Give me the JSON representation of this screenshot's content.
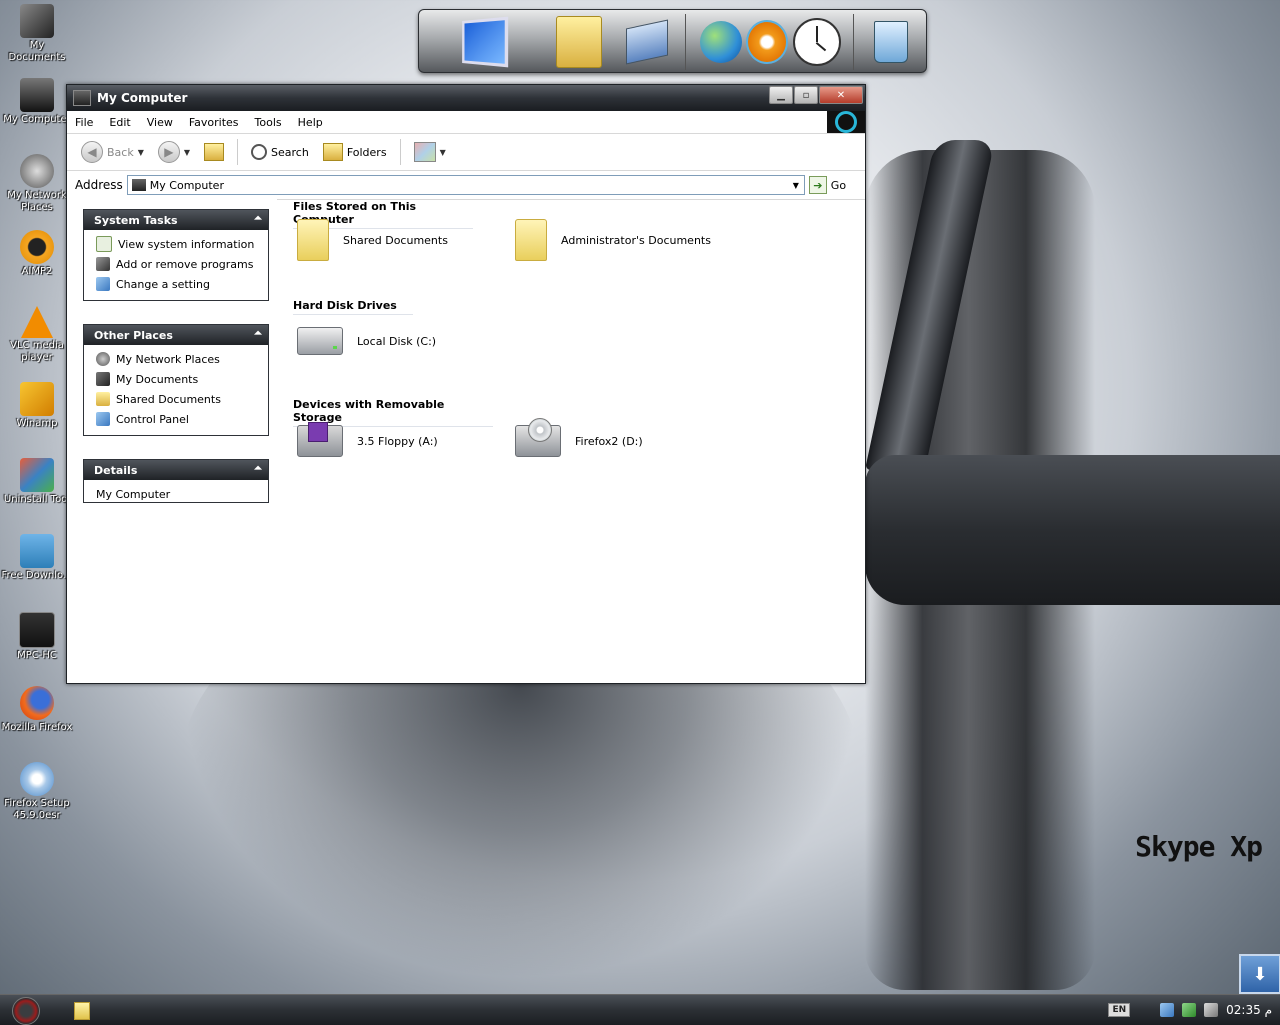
{
  "desktop": {
    "icons": [
      {
        "label": "My Documents"
      },
      {
        "label": "My Computer"
      },
      {
        "label": "My Network Places"
      },
      {
        "label": "AIMP2"
      },
      {
        "label": "VLC media player"
      },
      {
        "label": "Winamp"
      },
      {
        "label": "Uninstall Tool"
      },
      {
        "label": "Free Downlo..."
      },
      {
        "label": "MPC-HC"
      },
      {
        "label": "Mozilla Firefox"
      },
      {
        "label": "Firefox Setup 45.9.0esr"
      }
    ],
    "wallpaper_text": "Skype Xp"
  },
  "dock": {
    "items": [
      "monitor-icon",
      "folder-icon",
      "scanner-icon",
      "globe-icon",
      "media-player-icon",
      "clock-icon",
      "recycle-bin-icon"
    ]
  },
  "window": {
    "title": "My Computer",
    "menu": [
      "File",
      "Edit",
      "View",
      "Favorites",
      "Tools",
      "Help"
    ],
    "toolbar": {
      "back_label": "Back",
      "search_label": "Search",
      "folders_label": "Folders"
    },
    "address": {
      "label": "Address",
      "value": "My Computer",
      "go_label": "Go"
    },
    "taskpane": {
      "system_tasks": {
        "title": "System Tasks",
        "items": [
          "View system information",
          "Add or remove programs",
          "Change a setting"
        ]
      },
      "other_places": {
        "title": "Other Places",
        "items": [
          "My Network Places",
          "My Documents",
          "Shared Documents",
          "Control Panel"
        ]
      },
      "details": {
        "title": "Details",
        "body": "My Computer"
      }
    },
    "content": {
      "groups": [
        {
          "title": "Files Stored on This Computer",
          "items": [
            "Shared Documents",
            "Administrator's Documents"
          ]
        },
        {
          "title": "Hard Disk Drives",
          "items": [
            "Local Disk (C:)"
          ]
        },
        {
          "title": "Devices with Removable Storage",
          "items": [
            "3.5 Floppy (A:)",
            "Firefox2 (D:)"
          ]
        }
      ]
    }
  },
  "taskbar": {
    "language": "EN",
    "clock": "02:35  م"
  },
  "colors": {
    "panel_header": "#1f2226",
    "accent_logo": "#29b6d8"
  }
}
